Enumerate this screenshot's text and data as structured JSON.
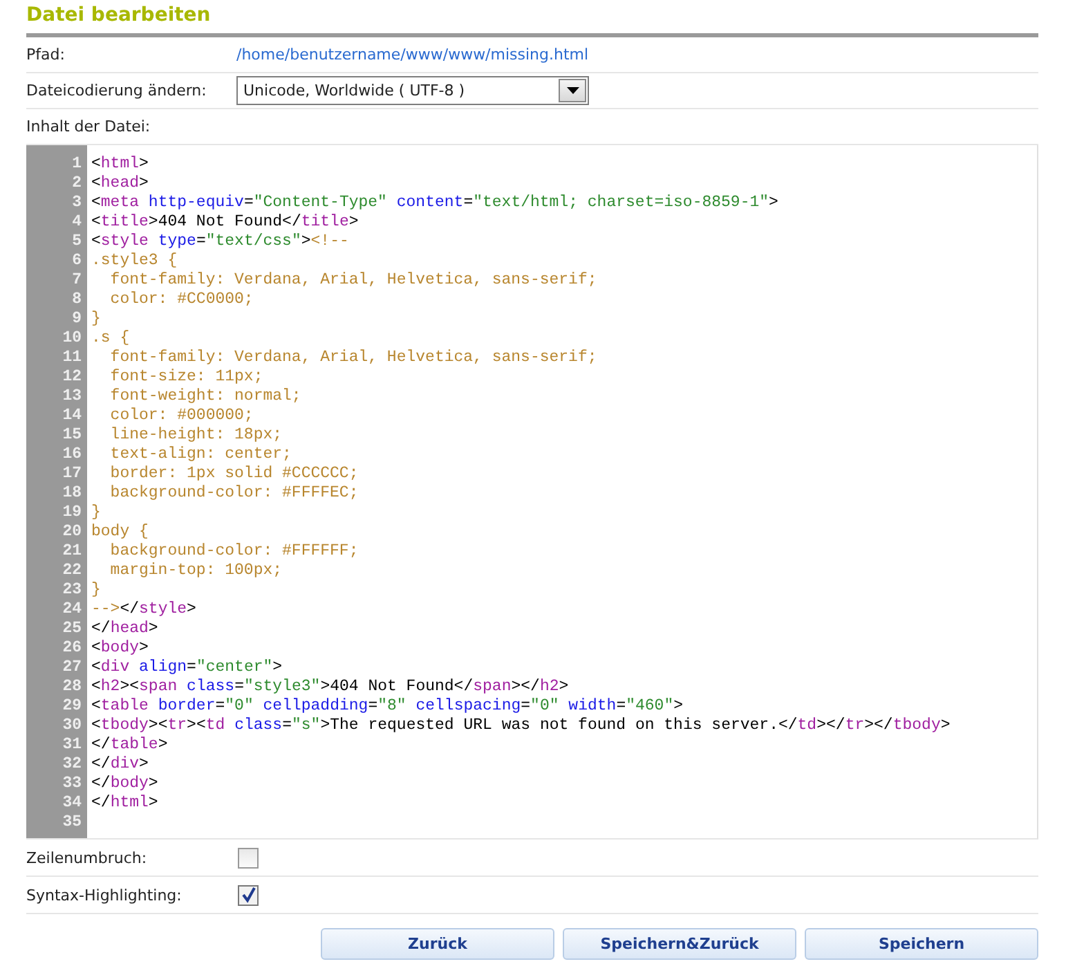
{
  "title": "Datei bearbeiten",
  "path": {
    "label": "Pfad:",
    "value": "/home/benutzername/www/www/missing.html"
  },
  "encoding": {
    "label": "Dateicodierung ändern:",
    "value": "Unicode, Worldwide ( UTF-8 )"
  },
  "content_label": "Inhalt der Datei:",
  "code_lines": [
    {
      "number": "1",
      "tokens": [
        {
          "kind": "text",
          "text": "<"
        },
        {
          "kind": "tag",
          "text": "html"
        },
        {
          "kind": "text",
          "text": ">"
        }
      ]
    },
    {
      "number": "2",
      "tokens": [
        {
          "kind": "text",
          "text": "<"
        },
        {
          "kind": "tag",
          "text": "head"
        },
        {
          "kind": "text",
          "text": ">"
        }
      ]
    },
    {
      "number": "3",
      "tokens": [
        {
          "kind": "text",
          "text": "<"
        },
        {
          "kind": "tag",
          "text": "meta"
        },
        {
          "kind": "attr",
          "text": " http-equiv"
        },
        {
          "kind": "text",
          "text": "="
        },
        {
          "kind": "value",
          "text": "\"Content-Type\""
        },
        {
          "kind": "attr",
          "text": " content"
        },
        {
          "kind": "text",
          "text": "="
        },
        {
          "kind": "value",
          "text": "\"text/html; charset=iso-8859-1\""
        },
        {
          "kind": "text",
          "text": ">"
        }
      ]
    },
    {
      "number": "4",
      "tokens": [
        {
          "kind": "text",
          "text": "<"
        },
        {
          "kind": "tag",
          "text": "title"
        },
        {
          "kind": "text",
          "text": ">404 Not Found</"
        },
        {
          "kind": "tag",
          "text": "title"
        },
        {
          "kind": "text",
          "text": ">"
        }
      ]
    },
    {
      "number": "5",
      "tokens": [
        {
          "kind": "text",
          "text": "<"
        },
        {
          "kind": "tag",
          "text": "style"
        },
        {
          "kind": "attr",
          "text": " type"
        },
        {
          "kind": "text",
          "text": "="
        },
        {
          "kind": "value",
          "text": "\"text/css\""
        },
        {
          "kind": "text",
          "text": ">"
        },
        {
          "kind": "css",
          "text": "<!--"
        }
      ]
    },
    {
      "number": "6",
      "tokens": [
        {
          "kind": "css",
          "text": ".style3 {"
        }
      ]
    },
    {
      "number": "7",
      "tokens": [
        {
          "kind": "css",
          "text": "  font-family: Verdana, Arial, Helvetica, sans-serif;"
        }
      ]
    },
    {
      "number": "8",
      "tokens": [
        {
          "kind": "css",
          "text": "  color: #CC0000;"
        }
      ]
    },
    {
      "number": "9",
      "tokens": [
        {
          "kind": "css",
          "text": "}"
        }
      ]
    },
    {
      "number": "10",
      "tokens": [
        {
          "kind": "css",
          "text": ".s {"
        }
      ]
    },
    {
      "number": "11",
      "tokens": [
        {
          "kind": "css",
          "text": "  font-family: Verdana, Arial, Helvetica, sans-serif;"
        }
      ]
    },
    {
      "number": "12",
      "tokens": [
        {
          "kind": "css",
          "text": "  font-size: 11px;"
        }
      ]
    },
    {
      "number": "13",
      "tokens": [
        {
          "kind": "css",
          "text": "  font-weight: normal;"
        }
      ]
    },
    {
      "number": "14",
      "tokens": [
        {
          "kind": "css",
          "text": "  color: #000000;"
        }
      ]
    },
    {
      "number": "15",
      "tokens": [
        {
          "kind": "css",
          "text": "  line-height: 18px;"
        }
      ]
    },
    {
      "number": "16",
      "tokens": [
        {
          "kind": "css",
          "text": "  text-align: center;"
        }
      ]
    },
    {
      "number": "17",
      "tokens": [
        {
          "kind": "css",
          "text": "  border: 1px solid #CCCCCC;"
        }
      ]
    },
    {
      "number": "18",
      "tokens": [
        {
          "kind": "css",
          "text": "  background-color: #FFFFEC;"
        }
      ]
    },
    {
      "number": "19",
      "tokens": [
        {
          "kind": "css",
          "text": "}"
        }
      ]
    },
    {
      "number": "20",
      "tokens": [
        {
          "kind": "css",
          "text": "body {"
        }
      ]
    },
    {
      "number": "21",
      "tokens": [
        {
          "kind": "css",
          "text": "  background-color: #FFFFFF;"
        }
      ]
    },
    {
      "number": "22",
      "tokens": [
        {
          "kind": "css",
          "text": "  margin-top: 100px;"
        }
      ]
    },
    {
      "number": "23",
      "tokens": [
        {
          "kind": "css",
          "text": "}"
        }
      ]
    },
    {
      "number": "24",
      "tokens": [
        {
          "kind": "css",
          "text": "-->"
        },
        {
          "kind": "text",
          "text": "</"
        },
        {
          "kind": "tag",
          "text": "style"
        },
        {
          "kind": "text",
          "text": ">"
        }
      ]
    },
    {
      "number": "25",
      "tokens": [
        {
          "kind": "text",
          "text": "</"
        },
        {
          "kind": "tag",
          "text": "head"
        },
        {
          "kind": "text",
          "text": ">"
        }
      ]
    },
    {
      "number": "26",
      "tokens": [
        {
          "kind": "text",
          "text": "<"
        },
        {
          "kind": "tag",
          "text": "body"
        },
        {
          "kind": "text",
          "text": ">"
        }
      ]
    },
    {
      "number": "27",
      "tokens": [
        {
          "kind": "text",
          "text": "<"
        },
        {
          "kind": "tag",
          "text": "div"
        },
        {
          "kind": "attr",
          "text": " align"
        },
        {
          "kind": "text",
          "text": "="
        },
        {
          "kind": "value",
          "text": "\"center\""
        },
        {
          "kind": "text",
          "text": ">"
        }
      ]
    },
    {
      "number": "28",
      "tokens": [
        {
          "kind": "text",
          "text": "<"
        },
        {
          "kind": "tag",
          "text": "h2"
        },
        {
          "kind": "text",
          "text": "><"
        },
        {
          "kind": "tag",
          "text": "span"
        },
        {
          "kind": "attr",
          "text": " class"
        },
        {
          "kind": "text",
          "text": "="
        },
        {
          "kind": "value",
          "text": "\"style3\""
        },
        {
          "kind": "text",
          "text": ">404 Not Found</"
        },
        {
          "kind": "tag",
          "text": "span"
        },
        {
          "kind": "text",
          "text": "></"
        },
        {
          "kind": "tag",
          "text": "h2"
        },
        {
          "kind": "text",
          "text": ">"
        }
      ]
    },
    {
      "number": "29",
      "tokens": [
        {
          "kind": "text",
          "text": "<"
        },
        {
          "kind": "tag",
          "text": "table"
        },
        {
          "kind": "attr",
          "text": " border"
        },
        {
          "kind": "text",
          "text": "="
        },
        {
          "kind": "value",
          "text": "\"0\""
        },
        {
          "kind": "attr",
          "text": " cellpadding"
        },
        {
          "kind": "text",
          "text": "="
        },
        {
          "kind": "value",
          "text": "\"8\""
        },
        {
          "kind": "attr",
          "text": " cellspacing"
        },
        {
          "kind": "text",
          "text": "="
        },
        {
          "kind": "value",
          "text": "\"0\""
        },
        {
          "kind": "attr",
          "text": " width"
        },
        {
          "kind": "text",
          "text": "="
        },
        {
          "kind": "value",
          "text": "\"460\""
        },
        {
          "kind": "text",
          "text": ">"
        }
      ]
    },
    {
      "number": "30",
      "tokens": [
        {
          "kind": "text",
          "text": "<"
        },
        {
          "kind": "tag",
          "text": "tbody"
        },
        {
          "kind": "text",
          "text": "><"
        },
        {
          "kind": "tag",
          "text": "tr"
        },
        {
          "kind": "text",
          "text": "><"
        },
        {
          "kind": "tag",
          "text": "td"
        },
        {
          "kind": "attr",
          "text": " class"
        },
        {
          "kind": "text",
          "text": "="
        },
        {
          "kind": "value",
          "text": "\"s\""
        },
        {
          "kind": "text",
          "text": ">The requested URL was not found on this server.</"
        },
        {
          "kind": "tag",
          "text": "td"
        },
        {
          "kind": "text",
          "text": "></"
        },
        {
          "kind": "tag",
          "text": "tr"
        },
        {
          "kind": "text",
          "text": "></"
        },
        {
          "kind": "tag",
          "text": "tbody"
        },
        {
          "kind": "text",
          "text": ">"
        }
      ]
    },
    {
      "number": "31",
      "tokens": [
        {
          "kind": "text",
          "text": "</"
        },
        {
          "kind": "tag",
          "text": "table"
        },
        {
          "kind": "text",
          "text": ">"
        }
      ]
    },
    {
      "number": "32",
      "tokens": [
        {
          "kind": "text",
          "text": "</"
        },
        {
          "kind": "tag",
          "text": "div"
        },
        {
          "kind": "text",
          "text": ">"
        }
      ]
    },
    {
      "number": "33",
      "tokens": [
        {
          "kind": "text",
          "text": "</"
        },
        {
          "kind": "tag",
          "text": "body"
        },
        {
          "kind": "text",
          "text": ">"
        }
      ]
    },
    {
      "number": "34",
      "tokens": [
        {
          "kind": "text",
          "text": "</"
        },
        {
          "kind": "tag",
          "text": "html"
        },
        {
          "kind": "text",
          "text": ">"
        }
      ]
    },
    {
      "number": "35"
    }
  ],
  "options": [
    {
      "label": "Zeilenumbruch:",
      "checked": false
    },
    {
      "label": "Syntax-Highlighting:",
      "checked": true
    }
  ],
  "buttons": [
    "Zurück",
    "Speichern&Zurück",
    "Speichern"
  ]
}
